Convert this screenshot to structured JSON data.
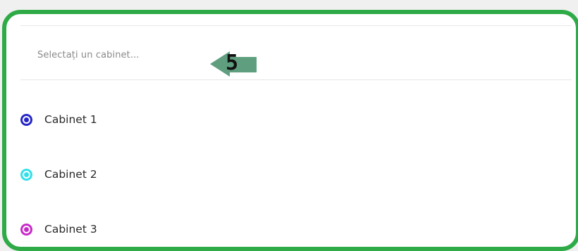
{
  "select": {
    "placeholder": "Selectați un cabinet..."
  },
  "step_marker": {
    "number": "5",
    "color": "#5f9f7f"
  },
  "frame": {
    "border_color": "#2eab47"
  },
  "options": [
    {
      "label": "Cabinet 1",
      "color": "#2626c8",
      "selected": false
    },
    {
      "label": "Cabinet 2",
      "color": "#33e0ea",
      "selected": false
    },
    {
      "label": "Cabinet 3",
      "color": "#c72ac8",
      "selected": false
    }
  ]
}
